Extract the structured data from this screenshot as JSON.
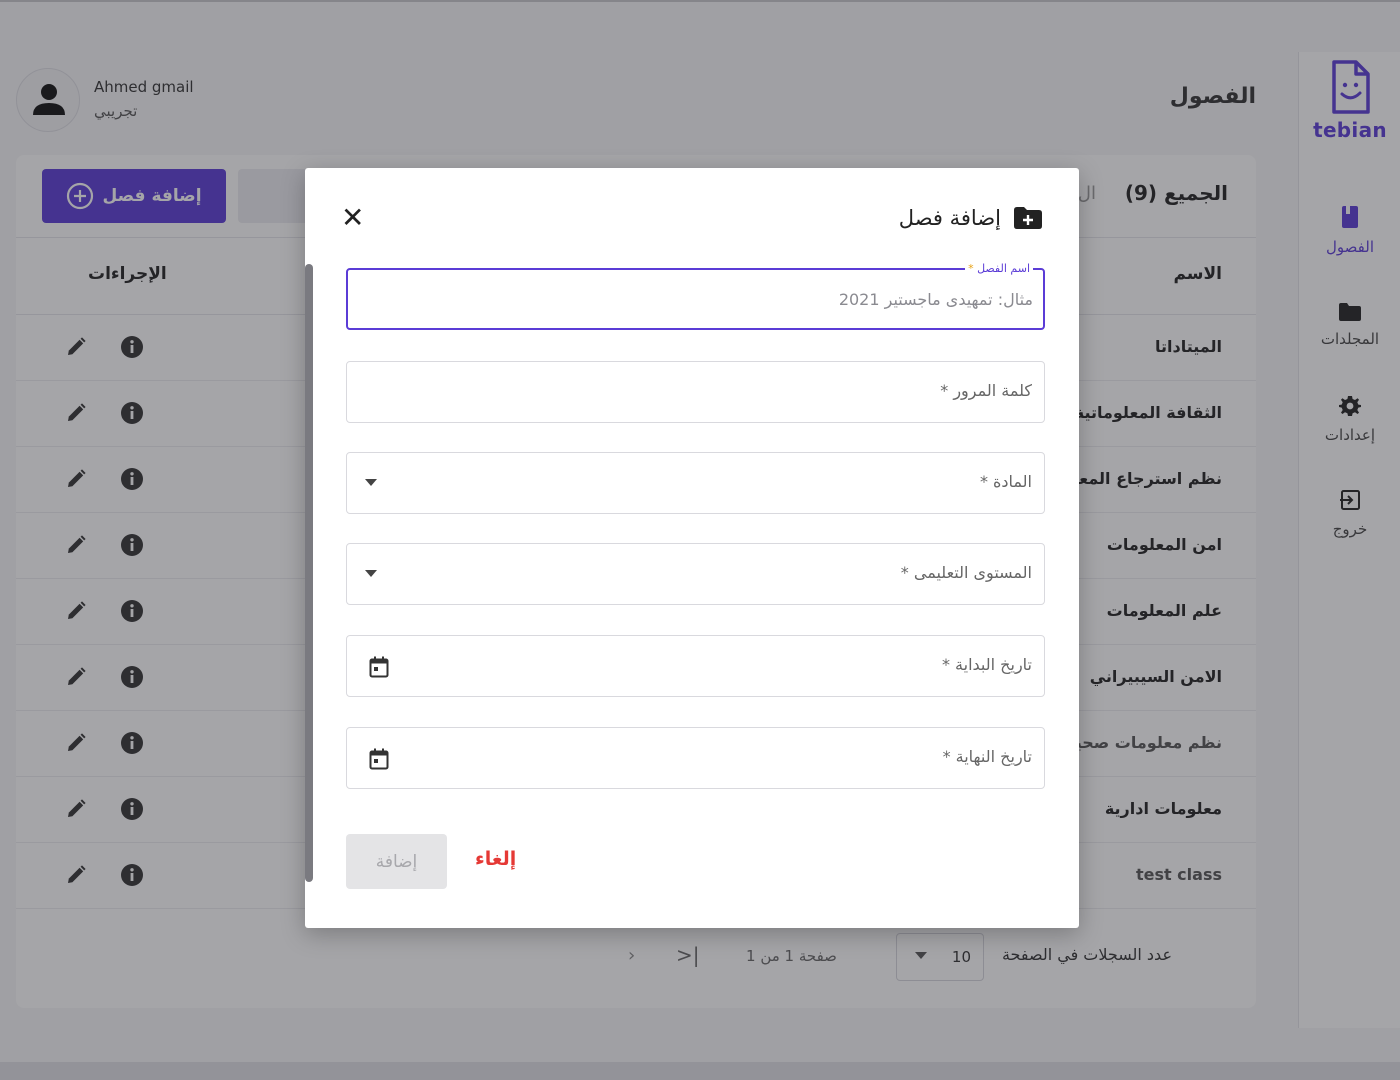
{
  "sidebar": {
    "brand": "tebian",
    "items": [
      {
        "label": "الفصول",
        "icon": "book-icon"
      },
      {
        "label": "المجلدات",
        "icon": "folder-icon"
      },
      {
        "label": "إعدادات",
        "icon": "gear-icon"
      },
      {
        "label": "خروج",
        "icon": "logout-icon"
      }
    ]
  },
  "user": {
    "name": "Ahmed gmail",
    "role": "تجريبي"
  },
  "page": {
    "title": "الفصول"
  },
  "toolbar": {
    "add_label": "إضافة فصل",
    "all_count": "الجميع (9)",
    "all_hint": "ال"
  },
  "table": {
    "col_name": "الاسم",
    "col_actions": "الإجراءات",
    "rows": [
      "الميتاداتا",
      "الثقافة المعلوماتية",
      "نظم استرجاع المعلومات",
      "امن المعلومات",
      "علم المعلومات",
      "الامن السيبيراني",
      "نظم معلومات صحية",
      "معلومات ادارية",
      "test class"
    ]
  },
  "pagination": {
    "rows_per_page_label": "عدد السجلات في الصفحة",
    "rows_per_page_value": "10",
    "page_info": "صفحة 1 من 1"
  },
  "modal": {
    "title": "إضافة فصل",
    "name_label": "اسم الفصل",
    "name_placeholder": "مثال: تمهيدى ماجستير 2021",
    "password_label": "كلمة المرور *",
    "subject_label": "المادة *",
    "level_label": "المستوى التعليمى *",
    "start_label": "تاريخ البداية *",
    "end_label": "تاريخ النهاية *",
    "submit_label": "إضافة",
    "cancel_label": "إلغاء"
  },
  "colors": {
    "accent": "#5b3cd6",
    "danger": "#e53935"
  }
}
